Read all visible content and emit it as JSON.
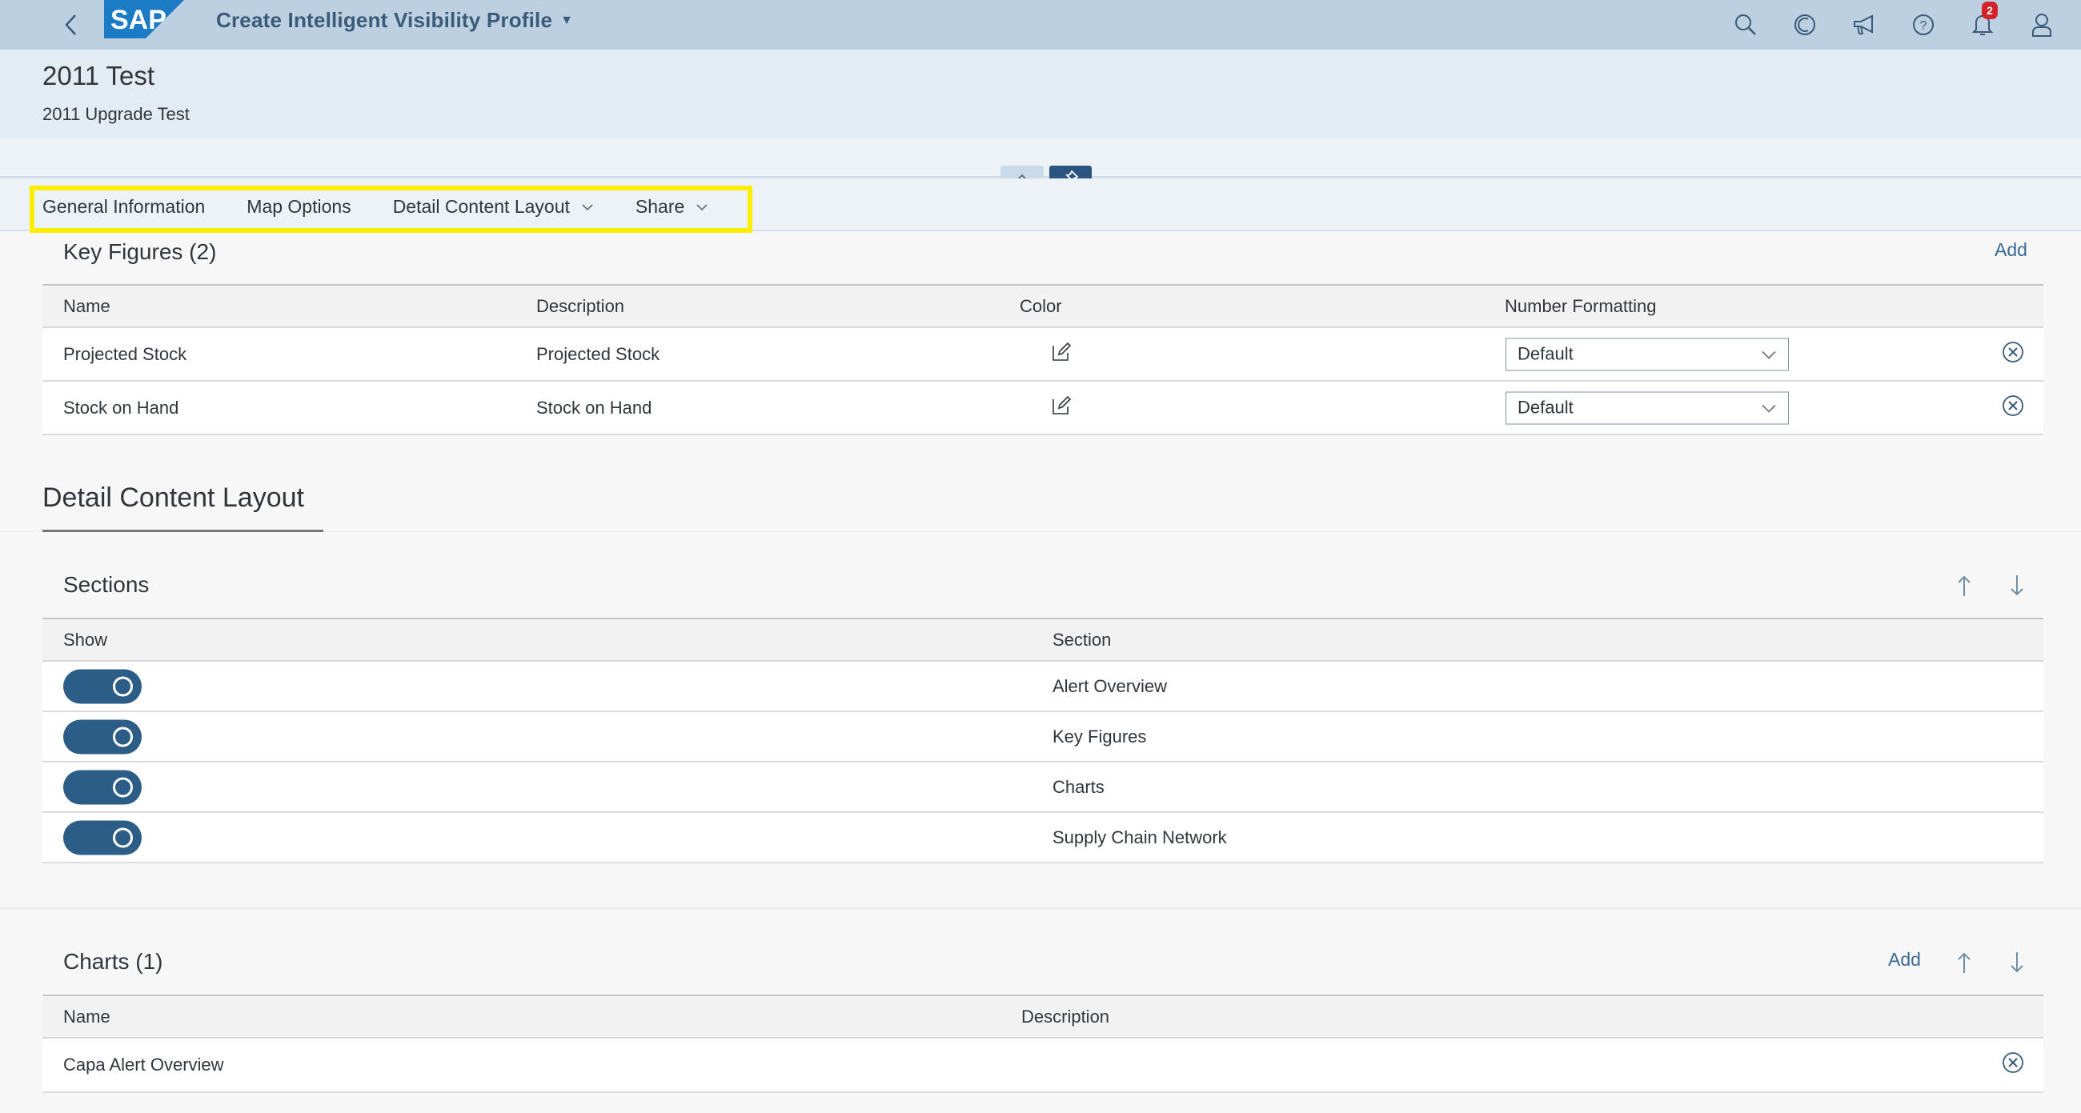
{
  "shell": {
    "app_title": "Create Intelligent Visibility Profile",
    "logo_text": "SAP",
    "notification_count": "2",
    "actions": [
      "search-icon",
      "copilot-icon",
      "whats-new-icon",
      "help-icon",
      "notifications-icon",
      "user-icon"
    ]
  },
  "object_header": {
    "title": "2011 Test",
    "subtitle": "2011 Upgrade Test"
  },
  "tabs": [
    {
      "label": "General Information",
      "has_menu": false
    },
    {
      "label": "Map Options",
      "has_menu": false
    },
    {
      "label": "Detail Content Layout",
      "has_menu": true
    },
    {
      "label": "Share",
      "has_menu": true
    }
  ],
  "key_figures": {
    "title": "Key Figures (2)",
    "add_label": "Add",
    "columns": [
      "Name",
      "Description",
      "Color",
      "Number Formatting"
    ],
    "rows": [
      {
        "name": "Projected Stock",
        "description": "Projected Stock",
        "color_icon": "edit-icon",
        "number_formatting": "Default"
      },
      {
        "name": "Stock on Hand",
        "description": "Stock on Hand",
        "color_icon": "edit-icon",
        "number_formatting": "Default"
      }
    ]
  },
  "detail_content_layout": {
    "title": "Detail Content Layout",
    "sections": {
      "title": "Sections",
      "columns": [
        "Show",
        "Section"
      ],
      "rows": [
        {
          "show": true,
          "section": "Alert Overview"
        },
        {
          "show": true,
          "section": "Key Figures"
        },
        {
          "show": true,
          "section": "Charts"
        },
        {
          "show": true,
          "section": "Supply Chain Network"
        }
      ]
    },
    "charts": {
      "title": "Charts (1)",
      "add_label": "Add",
      "columns": [
        "Name",
        "Description"
      ],
      "rows": [
        {
          "name": "Capa Alert Overview",
          "description": ""
        }
      ]
    }
  },
  "colors": {
    "shell_bg": "#bcd0e2",
    "accent": "#2b5d87",
    "highlight": "#ffee00",
    "link": "#3a6a94"
  }
}
